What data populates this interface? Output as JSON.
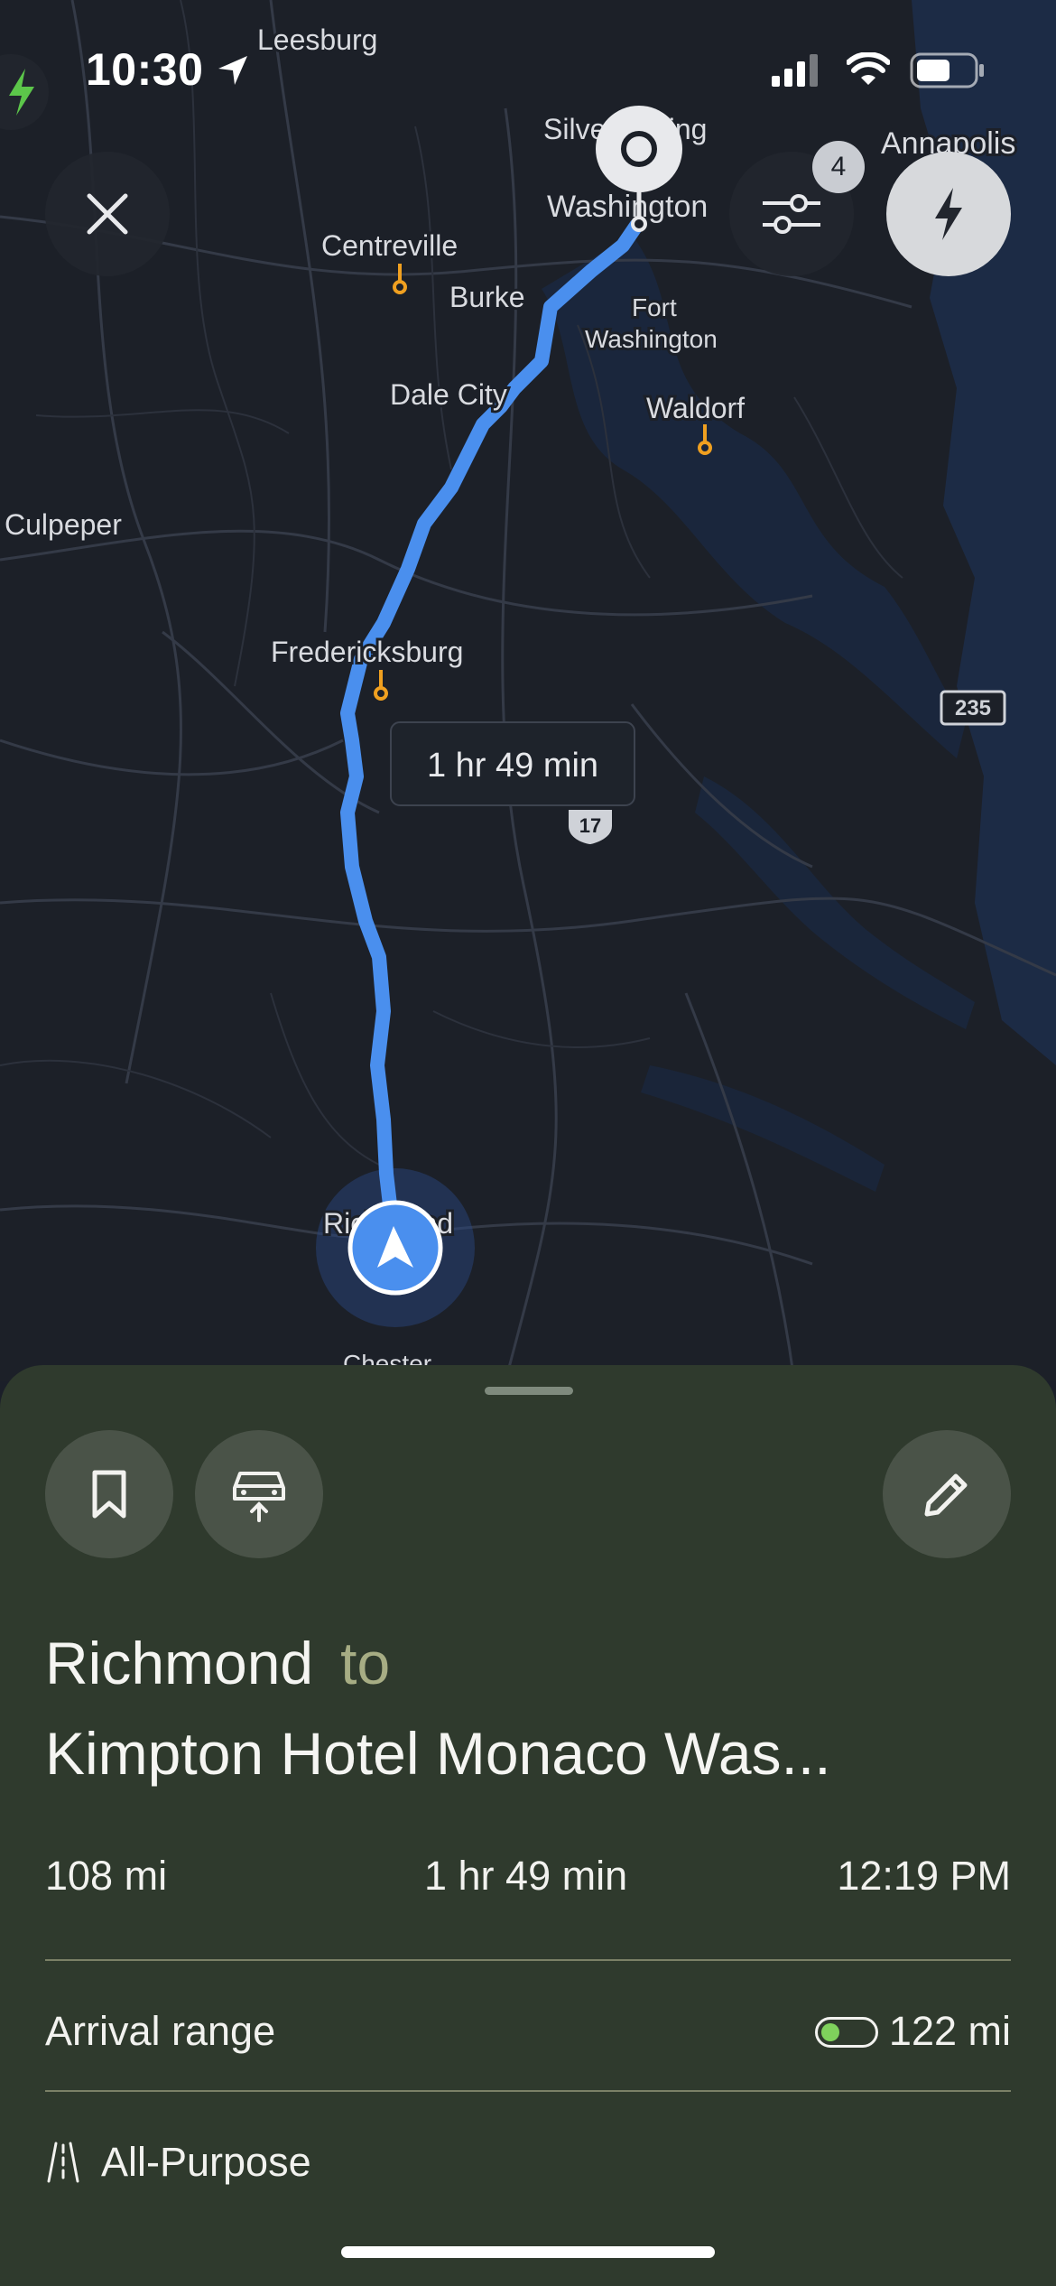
{
  "status_bar": {
    "time": "10:30"
  },
  "map": {
    "place_labels": {
      "leesburg": "Leesburg",
      "silver_spring": "Silver Spring",
      "annapolis": "Annapolis",
      "washington": "Washington",
      "centreville": "Centreville",
      "burke": "Burke",
      "fort_washington_1": "Fort",
      "fort_washington_2": "Washington",
      "dale_city": "Dale City",
      "waldorf": "Waldorf",
      "culpeper": "Culpeper",
      "fredericksburg": "Fredericksburg",
      "richmond": "Richmond",
      "chester": "Chester"
    },
    "route_duration_label": "1 hr 49 min",
    "route_shields": {
      "us17": "17",
      "r235": "235"
    },
    "filter_badge_count": "4",
    "colors": {
      "route": "#4a8fee",
      "charger": "#f0a020",
      "water": "#1c2b45",
      "land": "#1c2028"
    }
  },
  "sheet": {
    "origin": "Richmond",
    "to_word": "to",
    "destination": "Kimpton Hotel Monaco Was...",
    "distance": "108 mi",
    "duration": "1 hr 49 min",
    "arrival_time": "12:19 PM",
    "arrival_range_label": "Arrival range",
    "arrival_range_value": "122 mi",
    "arrival_battery_level": 0.35,
    "route_mode": "All-Purpose",
    "accent_color": "#2f3a2d"
  }
}
